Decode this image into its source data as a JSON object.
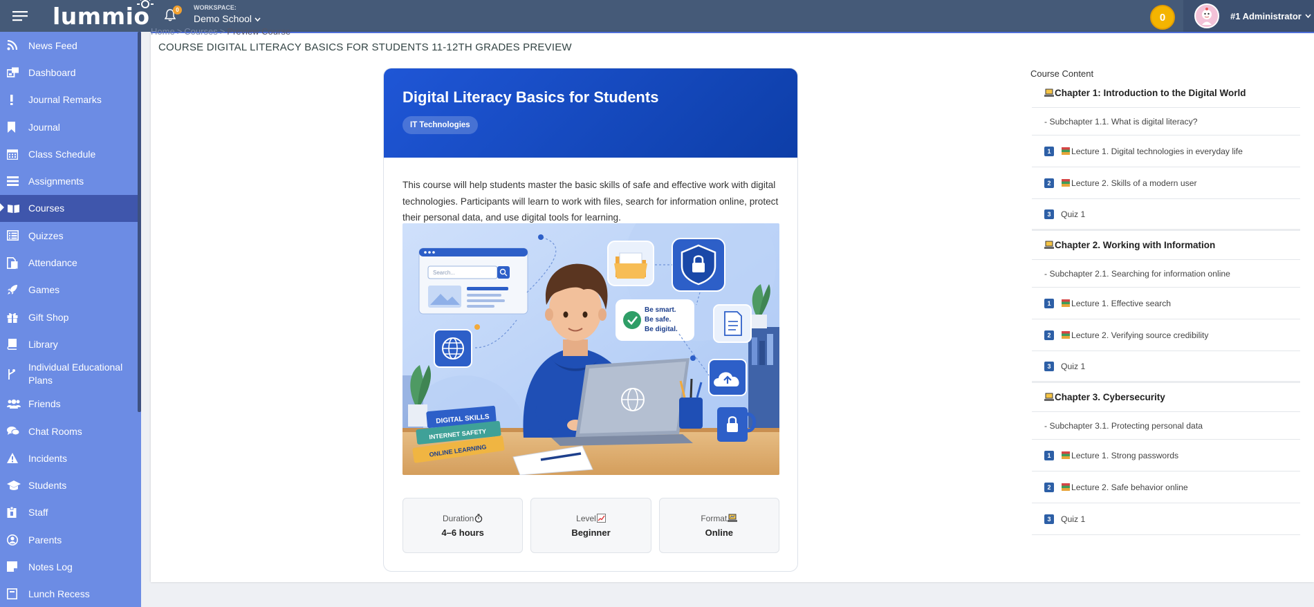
{
  "topbar": {
    "brand": "lummio",
    "notification_count": "0",
    "workspace_label": "WORKSPACE:",
    "workspace_name": "Demo School",
    "coins": "0",
    "user_name": "#1 Administrator"
  },
  "sidebar": {
    "items": [
      {
        "label": "News Feed",
        "icon": "rss-icon"
      },
      {
        "label": "Dashboard",
        "icon": "dashboard-icon"
      },
      {
        "label": "Journal Remarks",
        "icon": "exclamation-icon"
      },
      {
        "label": "Journal",
        "icon": "bookmark-icon"
      },
      {
        "label": "Class Schedule",
        "icon": "calendar-icon"
      },
      {
        "label": "Assignments",
        "icon": "list-icon"
      },
      {
        "label": "Courses",
        "icon": "book-open-icon",
        "active": true
      },
      {
        "label": "Quizzes",
        "icon": "checklist-icon"
      },
      {
        "label": "Attendance",
        "icon": "document-icon"
      },
      {
        "label": "Games",
        "icon": "rocket-icon"
      },
      {
        "label": "Gift Shop",
        "icon": "gift-icon"
      },
      {
        "label": "Library",
        "icon": "book-icon"
      },
      {
        "label": "Individual Educational Plans",
        "icon": "branch-icon"
      },
      {
        "label": "Friends",
        "icon": "users-icon"
      },
      {
        "label": "Chat Rooms",
        "icon": "chat-icon"
      },
      {
        "label": "Incidents",
        "icon": "warning-icon"
      },
      {
        "label": "Students",
        "icon": "graduation-cap-icon"
      },
      {
        "label": "Staff",
        "icon": "badge-icon"
      },
      {
        "label": "Parents",
        "icon": "user-circle-icon"
      },
      {
        "label": "Notes Log",
        "icon": "note-icon"
      },
      {
        "label": "Lunch Recess",
        "icon": "clock-icon"
      }
    ]
  },
  "breadcrumb": {
    "home": "Home",
    "courses": "Courses",
    "current": "Preview Course"
  },
  "page_title": "COURSE DIGITAL LITERACY BASICS FOR STUDENTS 11-12TH GRADES PREVIEW",
  "course": {
    "title": "Digital Literacy Basics for Students",
    "category": "IT Technologies",
    "description": "This course will help students master the basic skills of safe and effective work with digital technologies. Participants will learn to work with files, search for information online, protect their personal data, and use digital tools for learning.",
    "illustration": {
      "search_placeholder": "Search...",
      "slogan_1": "Be smart.",
      "slogan_2": "Be safe.",
      "slogan_3": "Be digital.",
      "book_1": "DIGITAL SKILLS",
      "book_2": "INTERNET SAFETY",
      "book_3": "ONLINE LEARNING"
    },
    "stats": [
      {
        "label": "Duration",
        "value": "4–6 hours",
        "icon": "stopwatch-icon"
      },
      {
        "label": "Level",
        "value": "Beginner",
        "icon": "chart-up-icon"
      },
      {
        "label": "Format",
        "value": "Online",
        "icon": "laptop-emoji-icon"
      }
    ]
  },
  "course_content": {
    "title": "Course Content",
    "chapters": [
      {
        "title": "Chapter 1: Introduction to the Digital World",
        "subchapter": "- Subchapter 1.1. What is digital literacy?",
        "items": [
          {
            "num": "1",
            "label": "Lecture 1. Digital technologies in everyday life"
          },
          {
            "num": "2",
            "label": "Lecture 2. Skills of a modern user"
          },
          {
            "num": "3",
            "label": "Quiz 1"
          }
        ]
      },
      {
        "title": "Chapter 2. Working with Information",
        "subchapter": "- Subchapter 2.1. Searching for information online",
        "items": [
          {
            "num": "1",
            "label": "Lecture 1. Effective search"
          },
          {
            "num": "2",
            "label": "Lecture 2. Verifying source credibility"
          },
          {
            "num": "3",
            "label": "Quiz 1"
          }
        ]
      },
      {
        "title": "Chapter 3. Cybersecurity",
        "subchapter": "- Subchapter 3.1. Protecting personal data",
        "items": [
          {
            "num": "1",
            "label": "Lecture 1. Strong passwords"
          },
          {
            "num": "2",
            "label": "Lecture 2. Safe behavior online"
          },
          {
            "num": "3",
            "label": "Quiz 1"
          }
        ]
      }
    ]
  }
}
